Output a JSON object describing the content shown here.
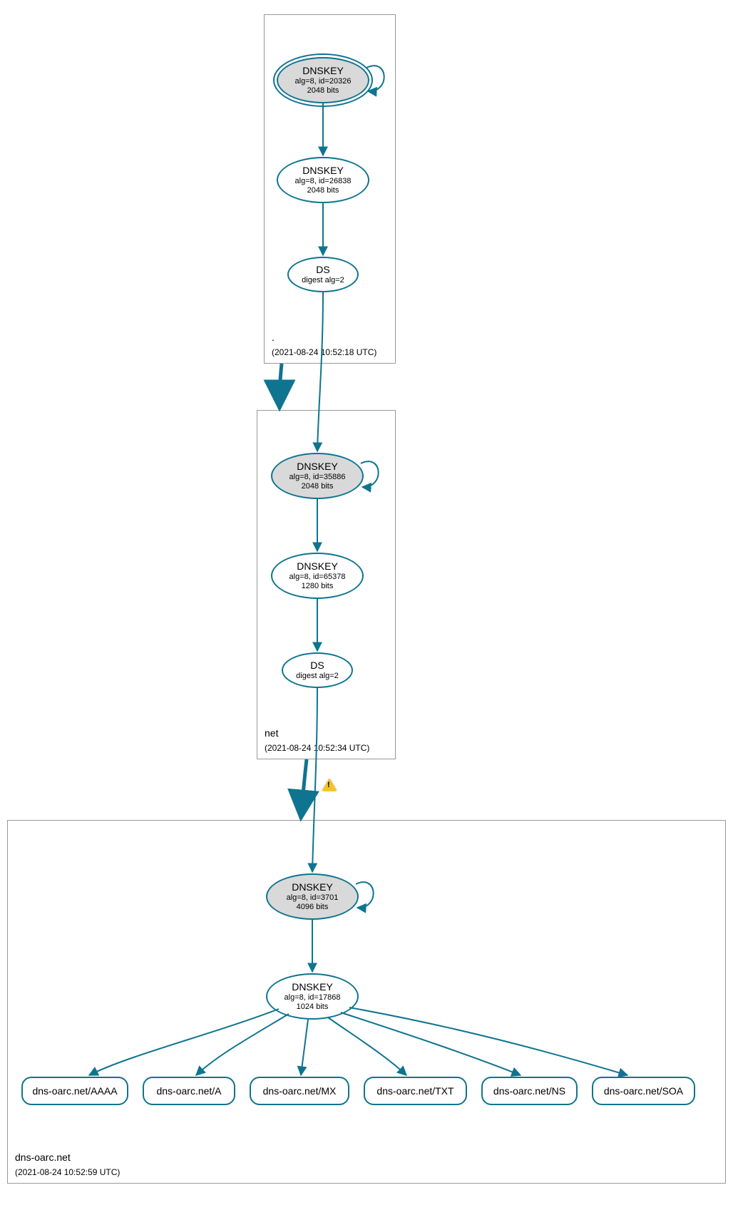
{
  "colors": {
    "stroke": "#0e7490",
    "fill_grey": "#d9d9d9"
  },
  "zones": {
    "root": {
      "name": ".",
      "timestamp": "(2021-08-24 10:52:18 UTC)"
    },
    "net": {
      "name": "net",
      "timestamp": "(2021-08-24 10:52:34 UTC)"
    },
    "leaf": {
      "name": "dns-oarc.net",
      "timestamp": "(2021-08-24 10:52:59 UTC)"
    }
  },
  "nodes": {
    "root_ksk": {
      "title": "DNSKEY",
      "sub1": "alg=8, id=20326",
      "sub2": "2048 bits"
    },
    "root_zsk": {
      "title": "DNSKEY",
      "sub1": "alg=8, id=26838",
      "sub2": "2048 bits"
    },
    "root_ds": {
      "title": "DS",
      "sub1": "digest alg=2"
    },
    "net_ksk": {
      "title": "DNSKEY",
      "sub1": "alg=8, id=35886",
      "sub2": "2048 bits"
    },
    "net_zsk": {
      "title": "DNSKEY",
      "sub1": "alg=8, id=65378",
      "sub2": "1280 bits"
    },
    "net_ds": {
      "title": "DS",
      "sub1": "digest alg=2"
    },
    "leaf_ksk": {
      "title": "DNSKEY",
      "sub1": "alg=8, id=3701",
      "sub2": "4096 bits"
    },
    "leaf_zsk": {
      "title": "DNSKEY",
      "sub1": "alg=8, id=17868",
      "sub2": "1024 bits"
    }
  },
  "records": {
    "aaaa": "dns-oarc.net/AAAA",
    "a": "dns-oarc.net/A",
    "mx": "dns-oarc.net/MX",
    "txt": "dns-oarc.net/TXT",
    "ns": "dns-oarc.net/NS",
    "soa": "dns-oarc.net/SOA"
  }
}
